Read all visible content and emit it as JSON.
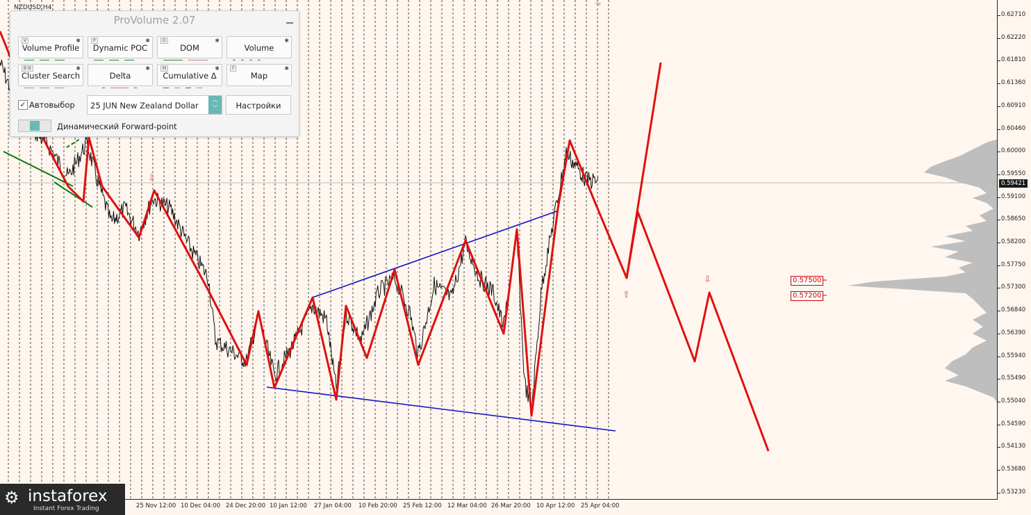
{
  "symbol": "NZDUSD,H4",
  "current_price": "0.59421",
  "price_axis": {
    "labels": [
      "0.62710",
      "0.62220",
      "0.61810",
      "0.61360",
      "0.60910",
      "0.60460",
      "0.60000",
      "0.59550",
      "0.59100",
      "0.58650",
      "0.58200",
      "0.57750",
      "0.57300",
      "0.56840",
      "0.56390",
      "0.55940",
      "0.55490",
      "0.55040",
      "0.54590",
      "0.54130",
      "0.53680",
      "0.53230"
    ]
  },
  "time_axis": {
    "labels": [
      "25 Nov 12:00",
      "10 Dec 04:00",
      "24 Dec 20:00",
      "10 Jan 12:00",
      "27 Jan 04:00",
      "10 Feb 20:00",
      "25 Feb 12:00",
      "12 Mar 04:00",
      "26 Mar 20:00",
      "10 Apr 12:00",
      "25 Apr 04:00"
    ]
  },
  "zones": [
    {
      "label": "0.57500"
    },
    {
      "label": "0.57200"
    }
  ],
  "panel": {
    "title": "ProVolume 2.07",
    "buttons": [
      {
        "label": "Volume Profile",
        "key": "V",
        "active": true
      },
      {
        "label": "Dynamic POC",
        "key": "P",
        "active": true
      },
      {
        "label": "DOM",
        "key": "D",
        "active": false
      },
      {
        "label": "Volume",
        "key": "",
        "active": false
      },
      {
        "label": "Cluster Search",
        "key": "B  N",
        "active": false
      },
      {
        "label": "Delta",
        "key": "",
        "active": false
      },
      {
        "label": "Cumulative Δ",
        "key": "M",
        "active": false
      },
      {
        "label": "Map",
        "key": "F",
        "active": false
      }
    ],
    "auto_select_label": "Автовыбор",
    "contract_value": "25 JUN New Zealand Dollar",
    "settings_label": "Настройки",
    "forward_point_label": "Динамический Forward-point"
  },
  "logo": {
    "name": "instaforex",
    "tagline": "Instant Forex Trading"
  },
  "colors": {
    "wave": "#e01010",
    "channel": "#1010c0",
    "trend_green": "#0a7a0a",
    "accent": "#68b9b5"
  }
}
